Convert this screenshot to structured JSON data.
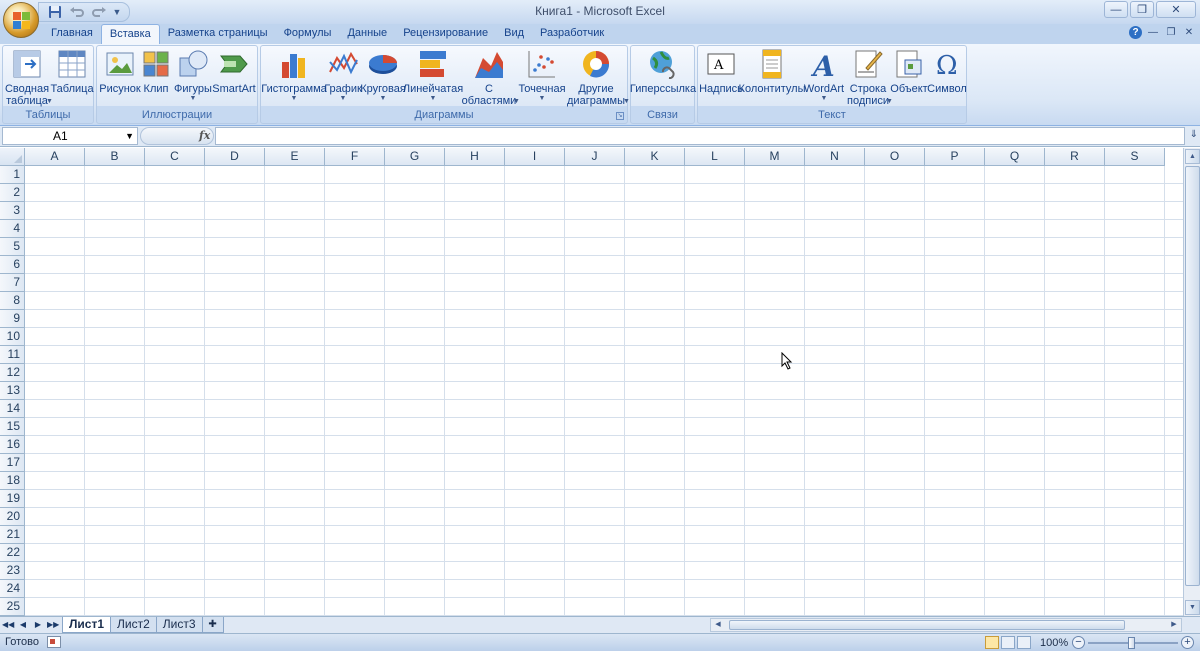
{
  "window": {
    "title": "Книга1 - Microsoft Excel"
  },
  "quick_access": {
    "items": [
      "save-icon",
      "undo-icon",
      "redo-icon",
      "customize-icon"
    ]
  },
  "tabs": [
    {
      "label": "Главная",
      "active": false
    },
    {
      "label": "Вставка",
      "active": true
    },
    {
      "label": "Разметка страницы",
      "active": false
    },
    {
      "label": "Формулы",
      "active": false
    },
    {
      "label": "Данные",
      "active": false
    },
    {
      "label": "Рецензирование",
      "active": false
    },
    {
      "label": "Вид",
      "active": false
    },
    {
      "label": "Разработчик",
      "active": false
    }
  ],
  "ribbon": {
    "tables": {
      "label": "Таблицы",
      "pivot_line1": "Сводная",
      "pivot_line2": "таблица",
      "table": "Таблица"
    },
    "illustrations": {
      "label": "Иллюстрации",
      "picture": "Рисунок",
      "clip": "Клип",
      "shapes": "Фигуры",
      "smartart": "SmartArt"
    },
    "charts": {
      "label": "Диаграммы",
      "column": "Гистограмма",
      "line": "График",
      "pie": "Круговая",
      "bar": "Линейчатая",
      "area_line1": "С",
      "area_line2": "областями",
      "scatter": "Точечная",
      "other_line1": "Другие",
      "other_line2": "диаграммы"
    },
    "links": {
      "label": "Связи",
      "hyperlink": "Гиперссылка"
    },
    "text": {
      "label": "Текст",
      "textbox": "Надпись",
      "header_footer": "Колонтитулы",
      "wordart": "WordArt",
      "signature_line1": "Строка",
      "signature_line2": "подписи",
      "object": "Объект",
      "symbol": "Символ"
    }
  },
  "formula_bar": {
    "name_box": "A1",
    "fx": "fx",
    "formula": ""
  },
  "grid": {
    "columns": [
      "A",
      "B",
      "C",
      "D",
      "E",
      "F",
      "G",
      "H",
      "I",
      "J",
      "K",
      "L",
      "M",
      "N",
      "O",
      "P",
      "Q",
      "R",
      "S"
    ],
    "rows": [
      "1",
      "2",
      "3",
      "4",
      "5",
      "6",
      "7",
      "8",
      "9",
      "10",
      "11",
      "12",
      "13",
      "14",
      "15",
      "16",
      "17",
      "18",
      "19",
      "20",
      "21",
      "22",
      "23",
      "24",
      "25"
    ]
  },
  "sheets": [
    {
      "label": "Лист1",
      "active": true
    },
    {
      "label": "Лист2",
      "active": false
    },
    {
      "label": "Лист3",
      "active": false
    }
  ],
  "status": {
    "text": "Готово",
    "zoom": "100%"
  },
  "colors": {
    "ribbon_blue": "#dbe7f6",
    "tab_text": "#15428b",
    "grid_line": "#d5dfeb",
    "header_bg": "#dde7f3"
  }
}
